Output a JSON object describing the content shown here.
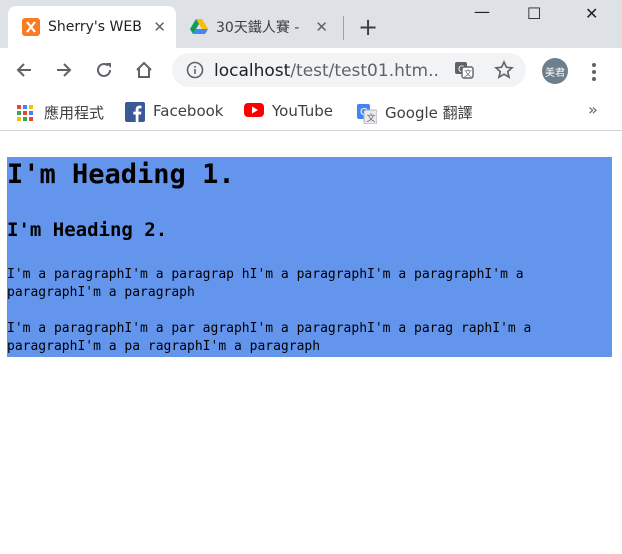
{
  "tabs": [
    {
      "title": "Sherry's WEB",
      "active": true
    },
    {
      "title": "30天鐵人賽 -",
      "active": false
    }
  ],
  "window_controls": {
    "minimize": "—",
    "maximize": "☐",
    "close": "✕"
  },
  "address": {
    "host": "localhost",
    "path": "/test/test01.htm..."
  },
  "profile": {
    "label": "美君"
  },
  "bookmarks": [
    {
      "label": "應用程式",
      "icon": "apps-grid-icon"
    },
    {
      "label": "Facebook",
      "icon": "facebook-icon"
    },
    {
      "label": "YouTube",
      "icon": "youtube-icon"
    },
    {
      "label": "Google 翻譯",
      "icon": "google-translate-icon"
    }
  ],
  "bookmarks_overflow": "»",
  "page": {
    "background": "#6495ed",
    "h1": "I'm Heading 1.",
    "h2": "I'm Heading 2.",
    "paragraphs": [
      "I'm a paragraphI'm a paragrap hI'm a paragraphI'm a paragraphI'm a paragraphI'm a paragraph",
      "I'm a paragraphI'm a par agraphI'm a paragraphI'm a parag raphI'm a paragraphI'm a pa ragraphI'm a paragraph"
    ]
  }
}
